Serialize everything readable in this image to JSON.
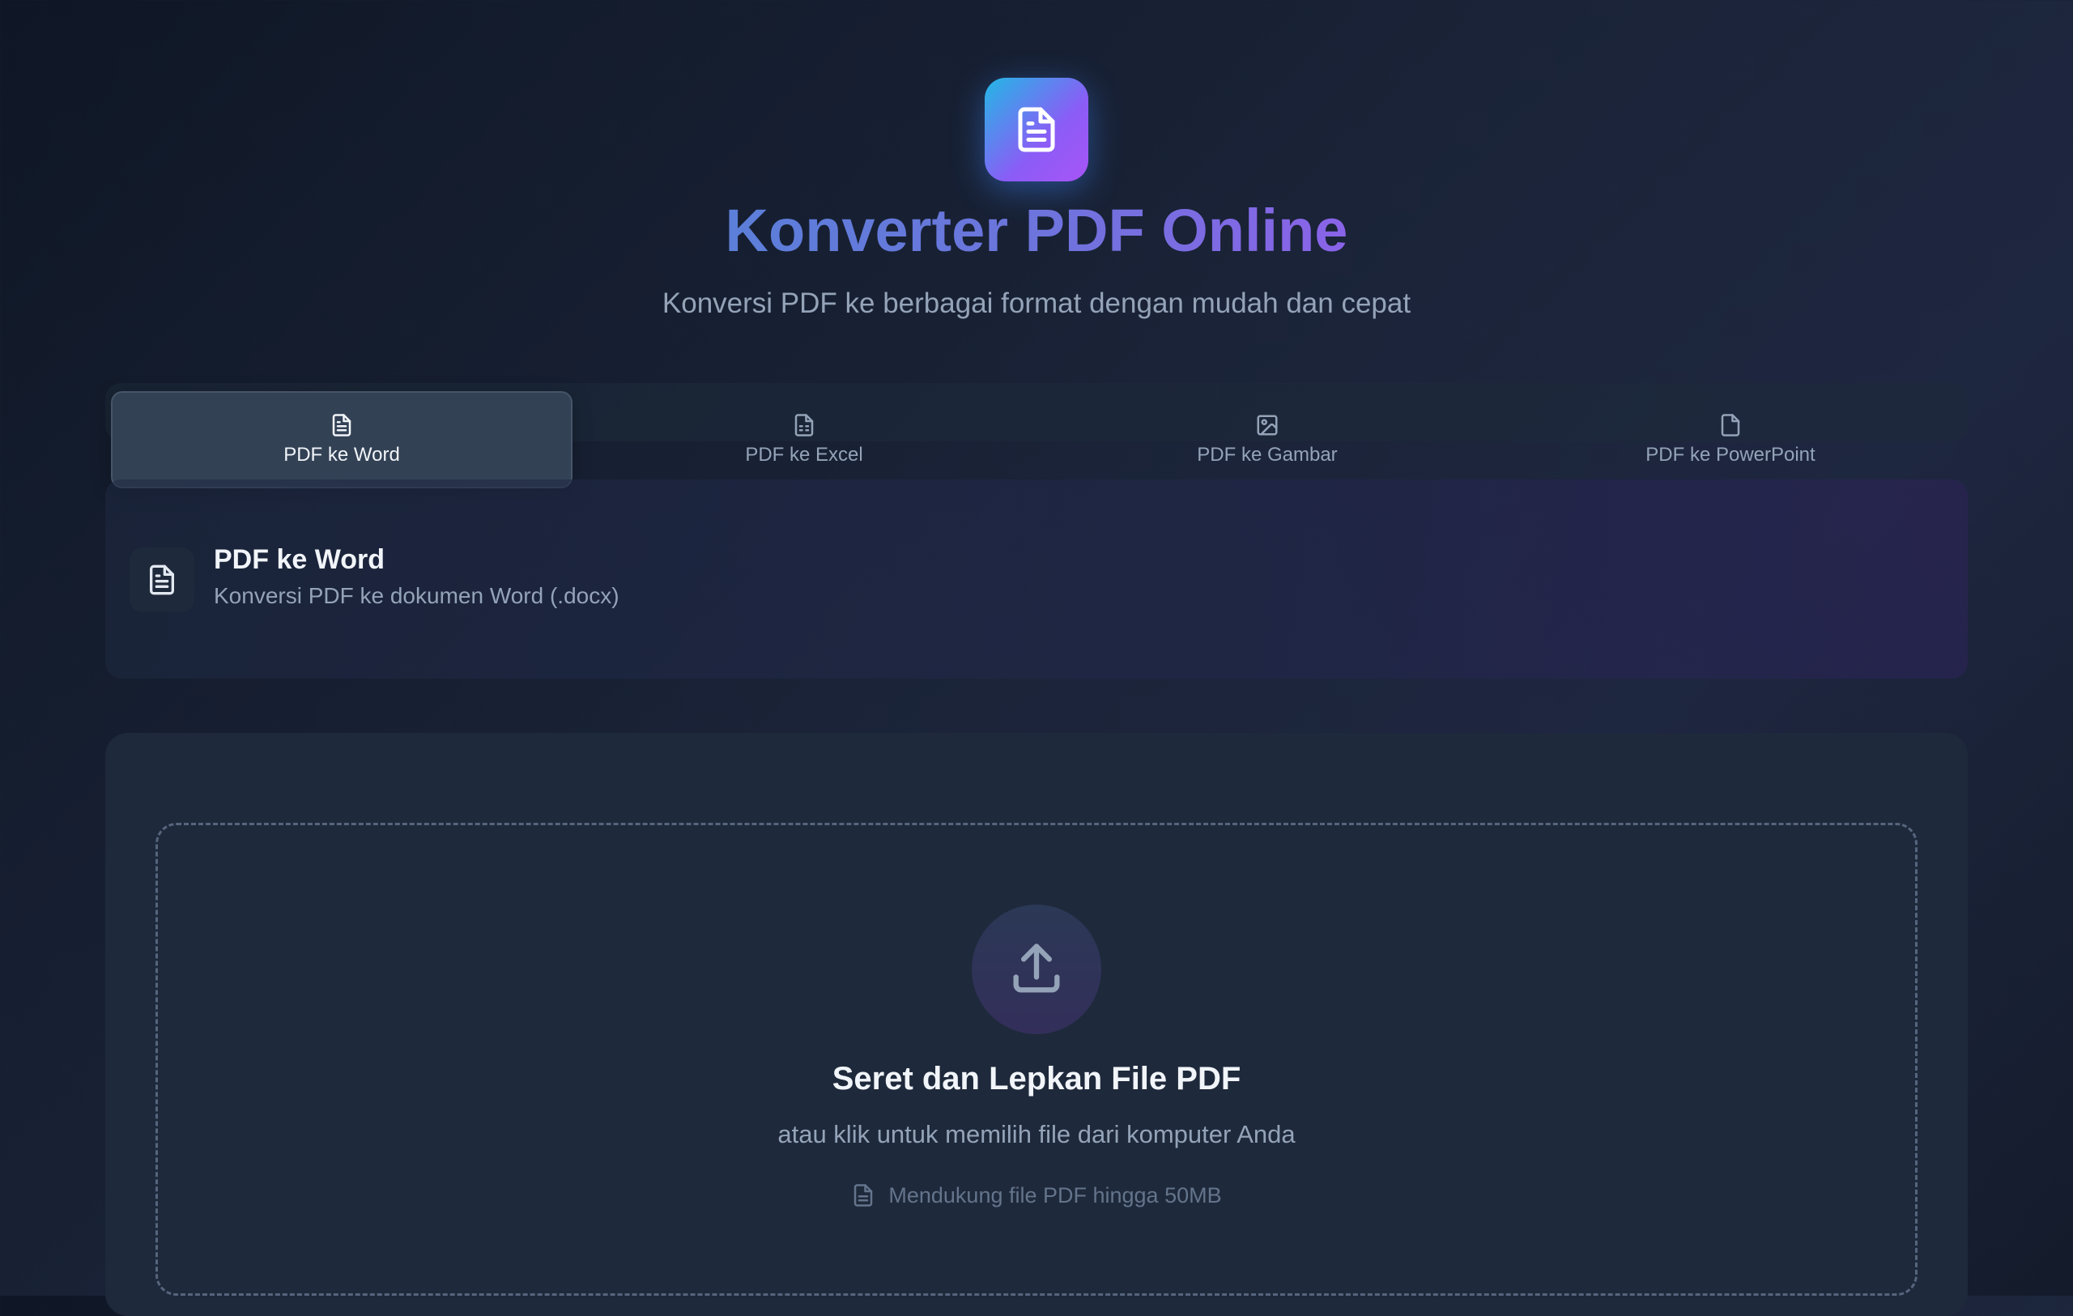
{
  "header": {
    "logo_icon": "file-text-icon",
    "title": "Konverter PDF Online",
    "subtitle": "Konversi PDF ke berbagai format dengan mudah dan cepat"
  },
  "tabs": [
    {
      "label": "PDF ke Word",
      "icon": "file-text-icon",
      "active": true
    },
    {
      "label": "PDF ke Excel",
      "icon": "file-spreadsheet-icon",
      "active": false
    },
    {
      "label": "PDF ke Gambar",
      "icon": "image-icon",
      "active": false
    },
    {
      "label": "PDF ke PowerPoint",
      "icon": "file-icon",
      "active": false
    }
  ],
  "info": {
    "icon": "file-text-icon",
    "title": "PDF ke Word",
    "description": "Konversi PDF ke dokumen Word (.docx)"
  },
  "upload": {
    "icon": "upload-icon",
    "title": "Seret dan Lepkan File PDF",
    "subtitle": "atau klik untuk memilih file dari komputer Anda",
    "note": "Mendukung file PDF hingga 50MB"
  },
  "colors": {
    "accent_start": "#22b8e6",
    "accent_end": "#a855f7",
    "background": "#1a2337",
    "card": "#1e293b"
  }
}
